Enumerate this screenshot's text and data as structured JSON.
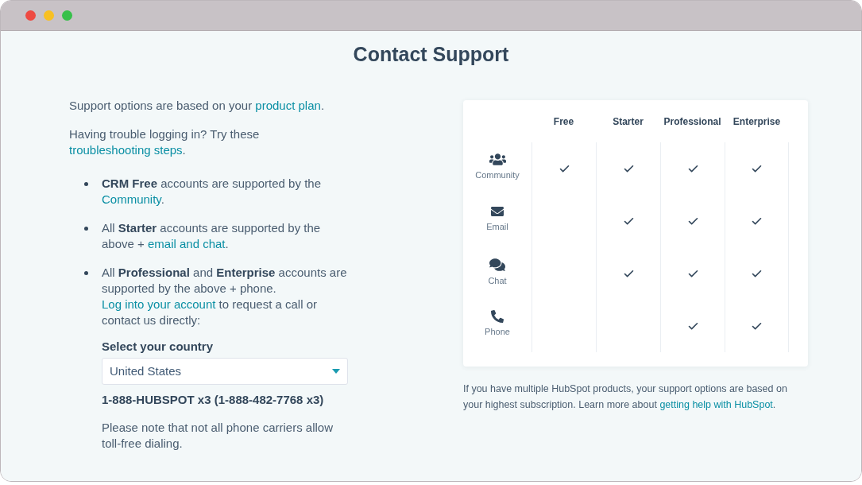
{
  "window": {
    "title": "Contact Support"
  },
  "intro": [
    [
      {
        "kind": "text",
        "text": "Support options are based on your "
      },
      {
        "kind": "link",
        "text": "product plan"
      },
      {
        "kind": "text",
        "text": "."
      }
    ],
    [
      {
        "kind": "text",
        "text": "Having trouble logging in? Try these "
      },
      {
        "kind": "link",
        "text": "troubleshooting steps"
      },
      {
        "kind": "text",
        "text": "."
      }
    ]
  ],
  "bullets": [
    {
      "segments": [
        {
          "kind": "bold",
          "text": "CRM Free"
        },
        {
          "kind": "text",
          "text": " accounts are supported by the "
        },
        {
          "kind": "link",
          "text": "Community"
        },
        {
          "kind": "text",
          "text": "."
        }
      ]
    },
    {
      "segments": [
        {
          "kind": "text",
          "text": "All "
        },
        {
          "kind": "bold",
          "text": "Starter"
        },
        {
          "kind": "text",
          "text": " accounts are supported by the above + "
        },
        {
          "kind": "link",
          "text": "email and chat"
        },
        {
          "kind": "text",
          "text": "."
        }
      ]
    },
    {
      "segments": [
        {
          "kind": "text",
          "text": "All "
        },
        {
          "kind": "bold",
          "text": "Professional"
        },
        {
          "kind": "text",
          "text": " and "
        },
        {
          "kind": "bold",
          "text": "Enterprise"
        },
        {
          "kind": "text",
          "text": " accounts are supported by the above + phone. "
        },
        {
          "kind": "link",
          "text": "Log into your account"
        },
        {
          "kind": "text",
          "text": " to request a call or contact us directly:"
        }
      ]
    }
  ],
  "phone_support": {
    "country_label": "Select your country",
    "country_select": {
      "value": "United States"
    },
    "number": "1-888-HUBSPOT x3 (1-888-482-7768 x3)",
    "note": "Please note that not all phone carriers allow toll-free dialing."
  },
  "support_table": {
    "columns": [
      "Free",
      "Starter",
      "Professional",
      "Enterprise"
    ],
    "rows": [
      {
        "kind": "community",
        "label": "Community",
        "available": [
          true,
          true,
          true,
          true
        ]
      },
      {
        "kind": "email",
        "label": "Email",
        "available": [
          false,
          true,
          true,
          true
        ]
      },
      {
        "kind": "chat",
        "label": "Chat",
        "available": [
          false,
          true,
          true,
          true
        ]
      },
      {
        "kind": "phone",
        "label": "Phone",
        "available": [
          false,
          false,
          true,
          true
        ]
      }
    ]
  },
  "footnote": [
    {
      "kind": "text",
      "text": "If you have multiple HubSpot products, your support options are based on your highest subscription. Learn more about "
    },
    {
      "kind": "link",
      "text": "getting help with HubSpot"
    },
    {
      "kind": "text",
      "text": "."
    }
  ]
}
